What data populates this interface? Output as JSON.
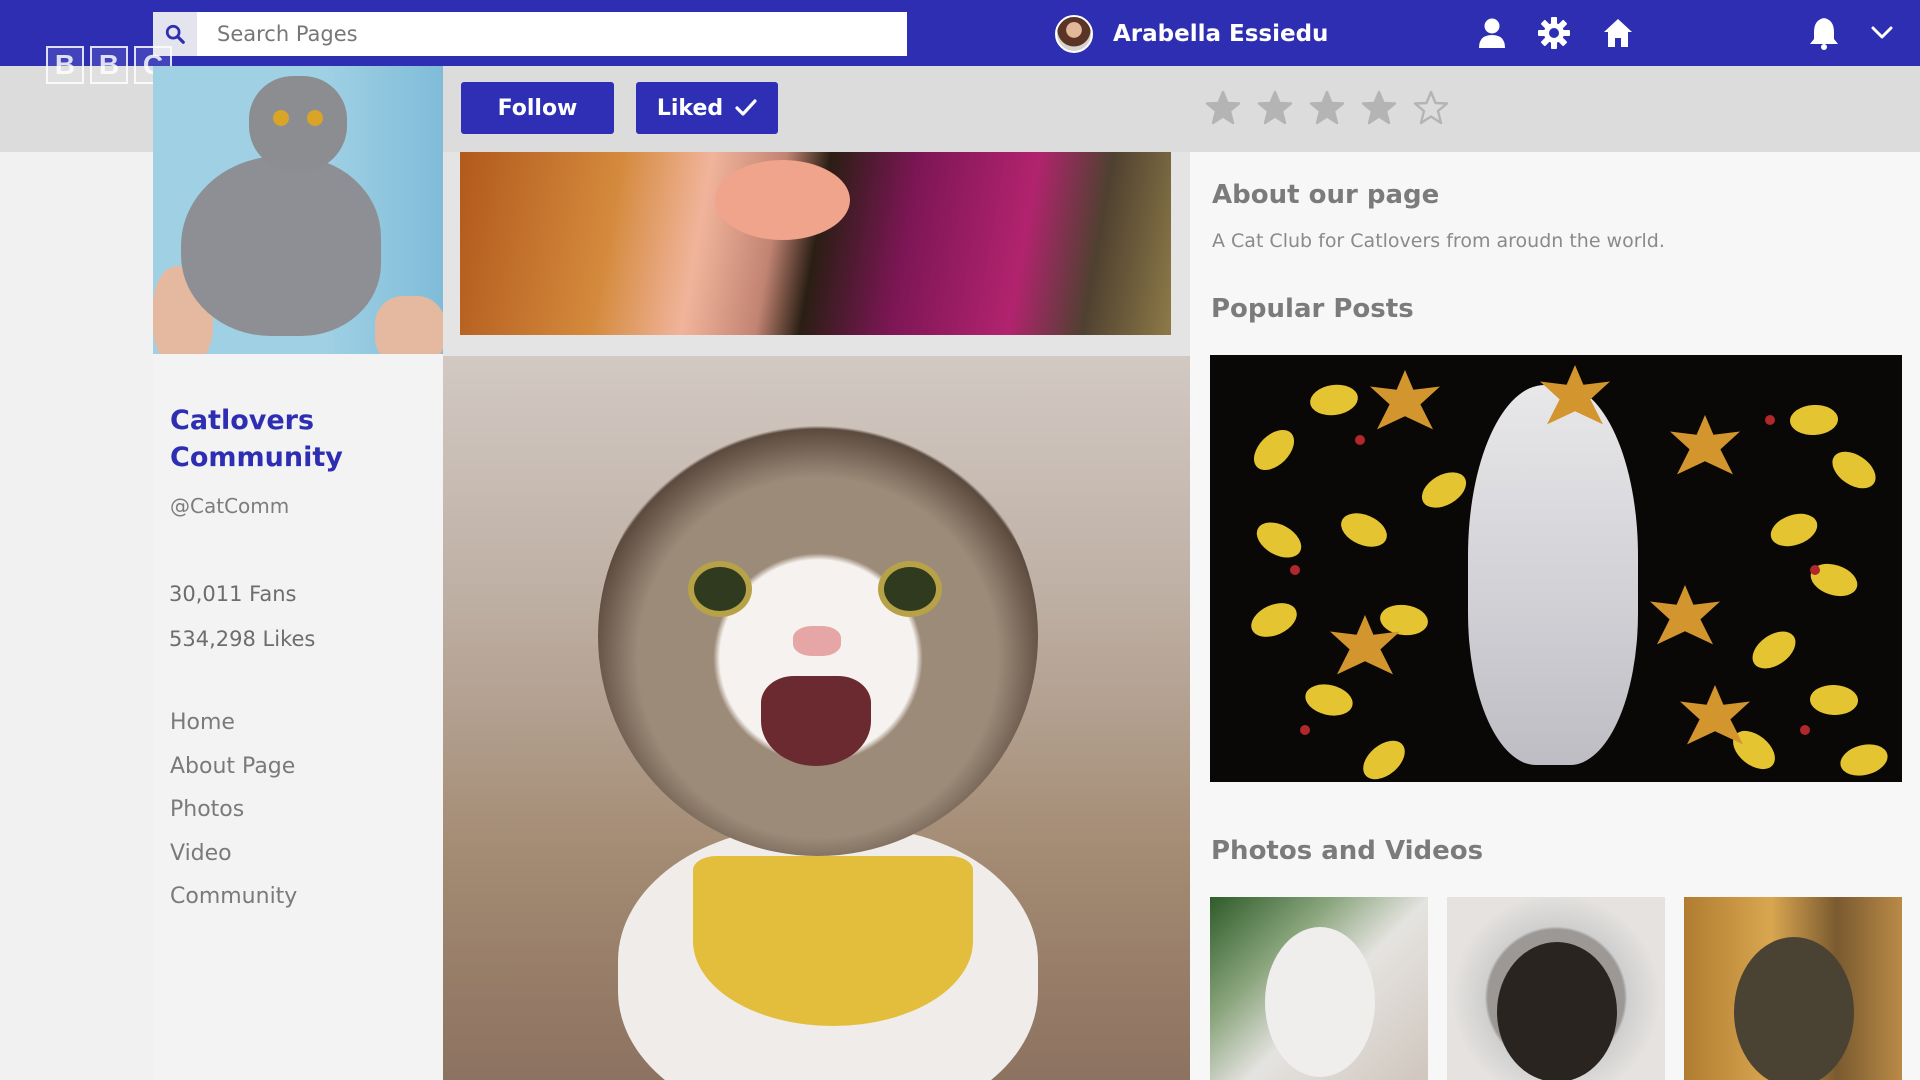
{
  "header": {
    "search_placeholder": "Search Pages",
    "user_name": "Arabella Essiedu",
    "icons": [
      "search-icon",
      "profile-icon",
      "gear-icon",
      "home-icon",
      "bell-icon",
      "chevron-down-icon"
    ]
  },
  "watermark": {
    "letters": [
      "B",
      "B",
      "C"
    ]
  },
  "actions": {
    "follow_label": "Follow",
    "liked_label": "Liked",
    "rating": {
      "value": 4,
      "max": 5
    }
  },
  "profile": {
    "name_line1": "Catlovers",
    "name_line2": "Community",
    "handle": "@CatComm",
    "fans_count": "30,011",
    "fans_label": "Fans",
    "likes_count": "534,298",
    "likes_label": "Likes"
  },
  "nav": {
    "items": [
      "Home",
      "About Page",
      "Photos",
      "Video",
      "Community"
    ]
  },
  "about": {
    "title": "About our page",
    "text": "A Cat Club for Catlovers from aroudn the world."
  },
  "popular": {
    "title": "Popular Posts"
  },
  "media": {
    "title": "Photos and Videos"
  },
  "colors": {
    "brand": "#2e2eb3",
    "star": "#b4b4b4"
  }
}
